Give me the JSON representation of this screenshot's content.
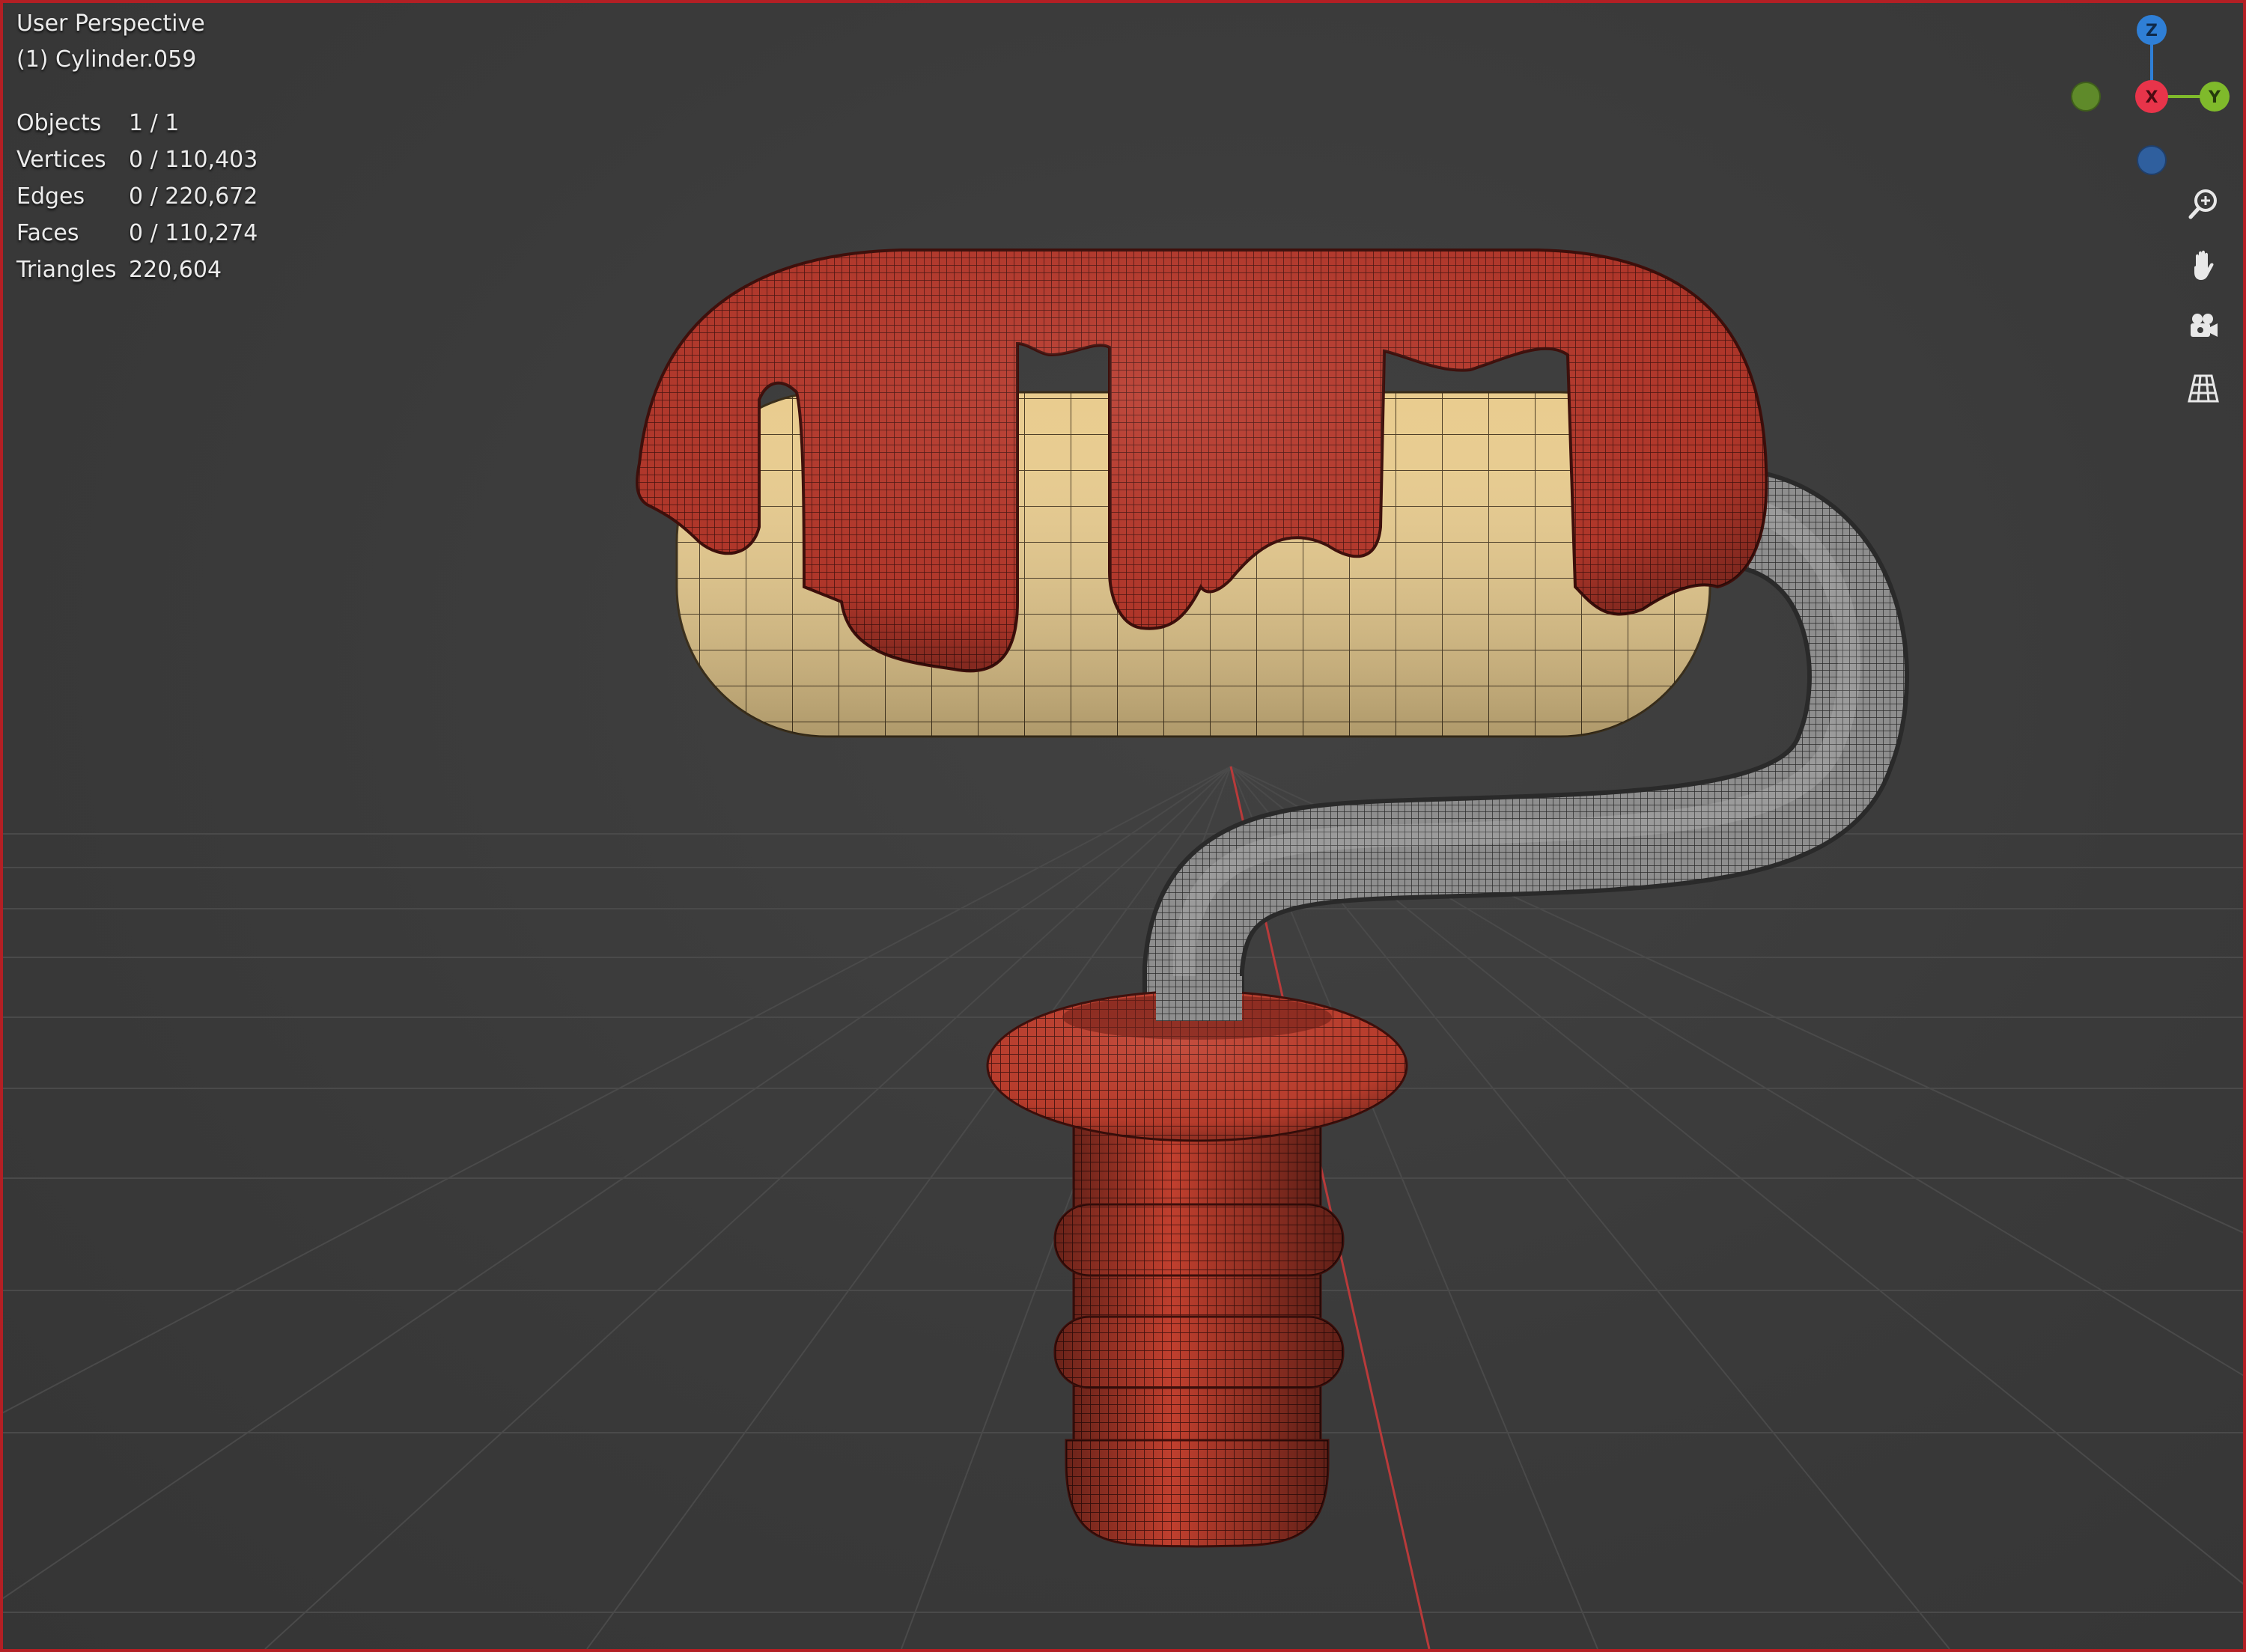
{
  "viewport": {
    "view_title": "User Perspective",
    "object_label": "(1) Cylinder.059",
    "border_color": "#b31f24",
    "background_color": "#3b3b3b"
  },
  "stats": [
    {
      "label": "Objects",
      "value": "1 / 1"
    },
    {
      "label": "Vertices",
      "value": "0 / 110,403"
    },
    {
      "label": "Edges",
      "value": "0 / 220,672"
    },
    {
      "label": "Faces",
      "value": "0 / 110,274"
    },
    {
      "label": "Triangles",
      "value": "220,604"
    }
  ],
  "gizmo": {
    "z_label": "Z",
    "x_label": "X",
    "y_label": "Y",
    "colors": {
      "x": "#e8344a",
      "y": "#7fba2b",
      "z": "#2f7fd6",
      "neg_y": "#5f8a2a",
      "neg_z": "#2f5f9e"
    }
  },
  "nav_buttons": [
    {
      "name": "zoom-icon"
    },
    {
      "name": "pan-hand-icon"
    },
    {
      "name": "camera-icon"
    },
    {
      "name": "perspective-grid-icon"
    }
  ],
  "model": {
    "paint_color": "#b5342a",
    "roller_color": "#e6c98a",
    "handle_color": "#8a8a8a",
    "grip_color": "#b83b2c"
  }
}
